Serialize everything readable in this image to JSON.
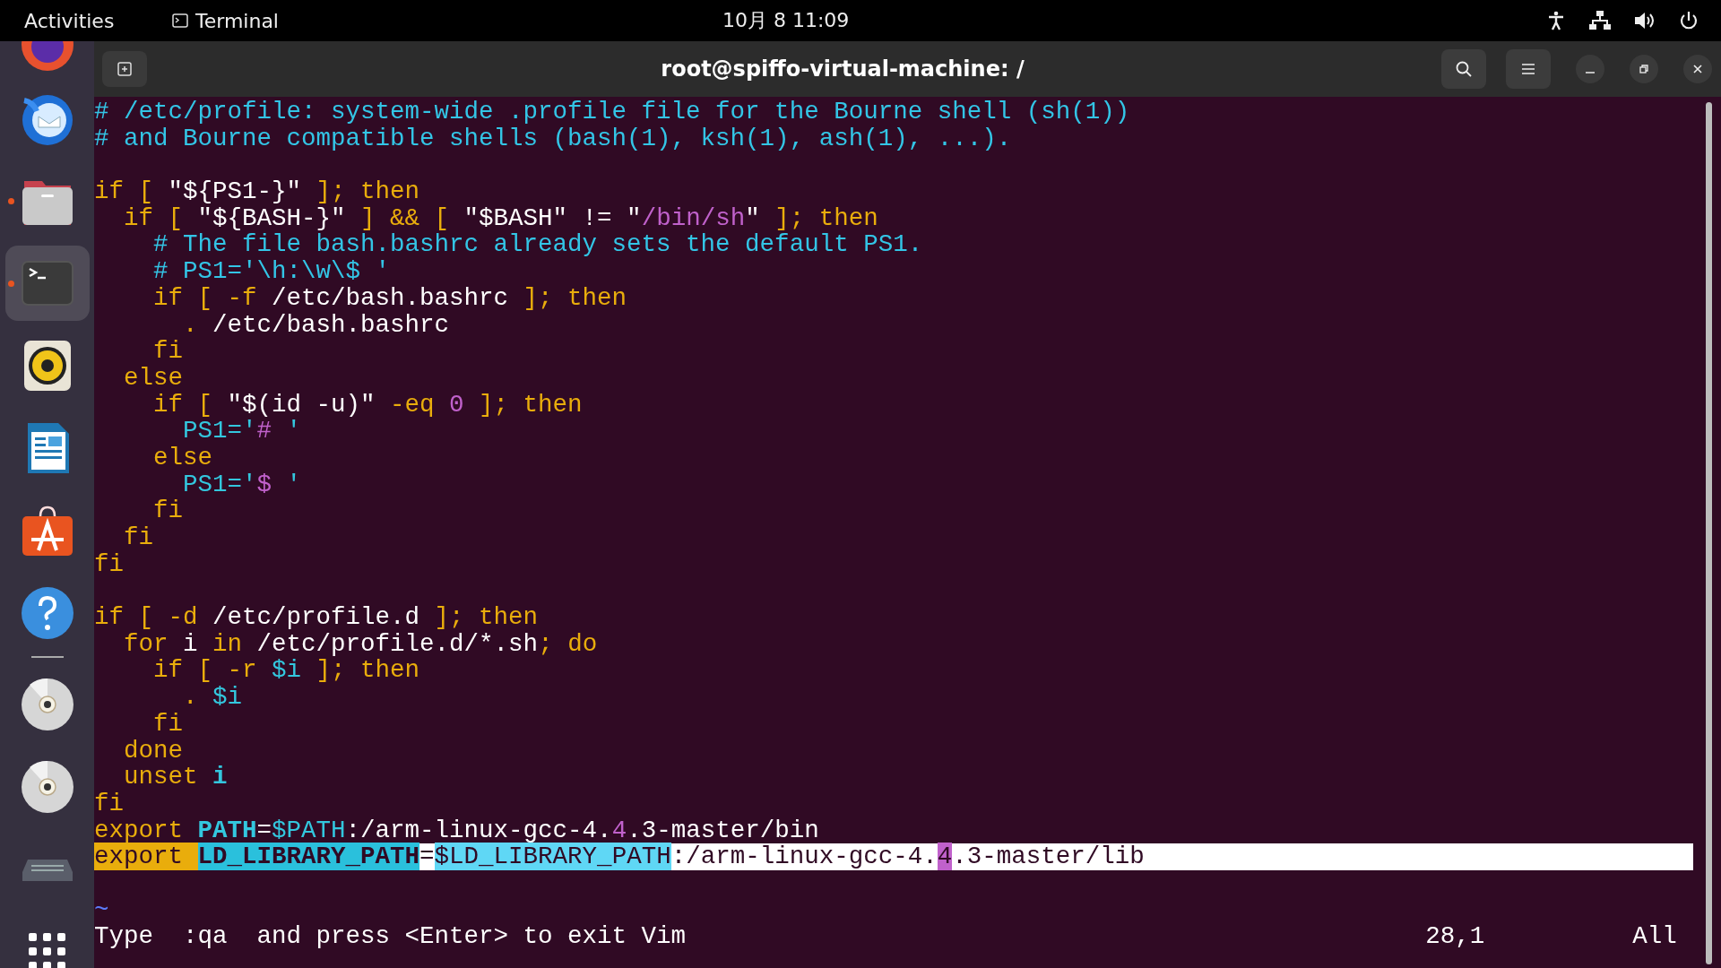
{
  "top_bar": {
    "activities": "Activities",
    "app_name": "Terminal",
    "clock": "10月 8  11:09"
  },
  "dock": [
    {
      "kind": "browser",
      "running": false,
      "selected": false
    },
    {
      "kind": "mail",
      "running": false,
      "selected": false
    },
    {
      "kind": "files",
      "running": true,
      "selected": false
    },
    {
      "kind": "terminal",
      "running": true,
      "selected": true
    },
    {
      "kind": "speaker",
      "running": false,
      "selected": false
    },
    {
      "kind": "document",
      "running": false,
      "selected": false
    },
    {
      "kind": "store",
      "running": false,
      "selected": false
    },
    {
      "kind": "help",
      "running": false,
      "selected": false
    },
    {
      "kind": "separator"
    },
    {
      "kind": "disc",
      "running": false,
      "selected": false
    },
    {
      "kind": "disc",
      "running": false,
      "selected": false
    },
    {
      "kind": "drive",
      "running": false,
      "selected": false
    },
    {
      "kind": "grid",
      "running": false,
      "selected": false
    }
  ],
  "window": {
    "title": "root@spiffo-virtual-machine: /"
  },
  "editor": {
    "lines": [
      {
        "selected": false,
        "segments": [
          {
            "text": "# /etc/profile: system-wide .profile file for the Bourne shell (sh(1))",
            "kind": "comment"
          }
        ]
      },
      {
        "selected": false,
        "segments": [
          {
            "text": "# and Bourne compatible shells (bash(1), ksh(1), ash(1), ...).",
            "kind": "comment"
          }
        ]
      },
      {
        "selected": false
      },
      {
        "selected": false,
        "segments": [
          {
            "text": "if [ ",
            "kind": "keyword"
          },
          {
            "text": "\"${PS1-}\"",
            "kind": "plain"
          },
          {
            "text": " ]; then",
            "kind": "keyword"
          }
        ]
      },
      {
        "selected": false,
        "segments": [
          {
            "text": "  if [ ",
            "kind": "keyword"
          },
          {
            "text": "\"${BASH-}\"",
            "kind": "plain"
          },
          {
            "text": " ] && [ ",
            "kind": "keyword"
          },
          {
            "text": "\"$BASH\" != \"",
            "kind": "plain"
          },
          {
            "text": "/bin/sh",
            "kind": "string"
          },
          {
            "text": "\"",
            "kind": "plain"
          },
          {
            "text": " ]; then",
            "kind": "keyword"
          }
        ]
      },
      {
        "selected": false,
        "segments": [
          {
            "text": "    # The file bash.bashrc already sets the default PS1.",
            "kind": "comment"
          }
        ]
      },
      {
        "selected": false,
        "segments": [
          {
            "text": "    # PS1='\\h:\\w\\$ '",
            "kind": "comment"
          }
        ]
      },
      {
        "selected": false,
        "segments": [
          {
            "text": "    if [ -f ",
            "kind": "keyword"
          },
          {
            "text": "/etc/bash.bashrc",
            "kind": "plain"
          },
          {
            "text": " ]; then",
            "kind": "keyword"
          }
        ]
      },
      {
        "selected": false,
        "segments": [
          {
            "text": "      . ",
            "kind": "keyword"
          },
          {
            "text": "/etc/bash.bashrc",
            "kind": "plain"
          }
        ]
      },
      {
        "selected": false,
        "segments": [
          {
            "text": "    fi",
            "kind": "keyword"
          }
        ]
      },
      {
        "selected": false,
        "segments": [
          {
            "text": "  else",
            "kind": "keyword"
          }
        ]
      },
      {
        "selected": false,
        "segments": [
          {
            "text": "    if [ ",
            "kind": "keyword"
          },
          {
            "text": "\"$(id -u)\"",
            "kind": "plain"
          },
          {
            "text": " -eq ",
            "kind": "keyword"
          },
          {
            "text": "0",
            "kind": "string"
          },
          {
            "text": " ]; then",
            "kind": "keyword"
          }
        ]
      },
      {
        "selected": false,
        "segments": [
          {
            "text": "      PS1='",
            "kind": "variable"
          },
          {
            "text": "# ",
            "kind": "string"
          },
          {
            "text": "'",
            "kind": "variable"
          }
        ]
      },
      {
        "selected": false,
        "segments": [
          {
            "text": "    else",
            "kind": "keyword"
          }
        ]
      },
      {
        "selected": false,
        "segments": [
          {
            "text": "      PS1='",
            "kind": "variable"
          },
          {
            "text": "$ ",
            "kind": "string"
          },
          {
            "text": "'",
            "kind": "variable"
          }
        ]
      },
      {
        "selected": false,
        "segments": [
          {
            "text": "    fi",
            "kind": "keyword"
          }
        ]
      },
      {
        "selected": false,
        "segments": [
          {
            "text": "  fi",
            "kind": "keyword"
          }
        ]
      },
      {
        "selected": false,
        "segments": [
          {
            "text": "fi",
            "kind": "keyword"
          }
        ]
      },
      {
        "selected": false
      },
      {
        "selected": false,
        "segments": [
          {
            "text": "if [ -d ",
            "kind": "keyword"
          },
          {
            "text": "/etc/profile.d",
            "kind": "plain"
          },
          {
            "text": " ]; then",
            "kind": "keyword"
          }
        ]
      },
      {
        "selected": false,
        "segments": [
          {
            "text": "  for ",
            "kind": "keyword"
          },
          {
            "text": "i ",
            "kind": "plain"
          },
          {
            "text": "in ",
            "kind": "keyword"
          },
          {
            "text": "/etc/profile.d/*.sh",
            "kind": "plain"
          },
          {
            "text": "; do",
            "kind": "keyword"
          }
        ]
      },
      {
        "selected": false,
        "segments": [
          {
            "text": "    if [ -r ",
            "kind": "keyword"
          },
          {
            "text": "$i",
            "kind": "variable"
          },
          {
            "text": " ]; then",
            "kind": "keyword"
          }
        ]
      },
      {
        "selected": false,
        "segments": [
          {
            "text": "      . ",
            "kind": "keyword"
          },
          {
            "text": "$i",
            "kind": "variable"
          }
        ]
      },
      {
        "selected": false,
        "segments": [
          {
            "text": "    fi",
            "kind": "keyword"
          }
        ]
      },
      {
        "selected": false,
        "segments": [
          {
            "text": "  done",
            "kind": "keyword"
          }
        ]
      },
      {
        "selected": false,
        "segments": [
          {
            "text": "  unset ",
            "kind": "keyword"
          },
          {
            "text": "i",
            "kind": "identifier"
          }
        ]
      },
      {
        "selected": false,
        "segments": [
          {
            "text": "fi",
            "kind": "keyword"
          }
        ]
      },
      {
        "selected": false,
        "segments": [
          {
            "text": "export ",
            "kind": "keyword"
          },
          {
            "text": "PATH",
            "kind": "identifier"
          },
          {
            "text": "=",
            "kind": "plain"
          },
          {
            "text": "$PATH",
            "kind": "variable"
          },
          {
            "text": ":/arm-linux-gcc-4.",
            "kind": "plain"
          },
          {
            "text": "4",
            "kind": "string"
          },
          {
            "text": ".3-master/bin",
            "kind": "plain"
          }
        ]
      },
      {
        "selected": true,
        "segments": [
          {
            "text": "export ",
            "kind": "keyword"
          },
          {
            "text": "LD_LIBRARY_PATH",
            "kind": "identifier"
          },
          {
            "text": "=",
            "kind": "plain"
          },
          {
            "text": "$LD_LIBRARY_PATH",
            "kind": "variable"
          },
          {
            "text": ":/arm-linux-gcc-4.",
            "kind": "plain"
          },
          {
            "text": "4",
            "kind": "string"
          },
          {
            "text": ".3-master/lib",
            "kind": "plain"
          }
        ]
      },
      {
        "selected": false
      }
    ],
    "filler_lines": [
      "~"
    ],
    "message": "Type  :qa  and press <Enter> to exit Vim",
    "ruler": "28,1",
    "scroll_position": "All"
  }
}
